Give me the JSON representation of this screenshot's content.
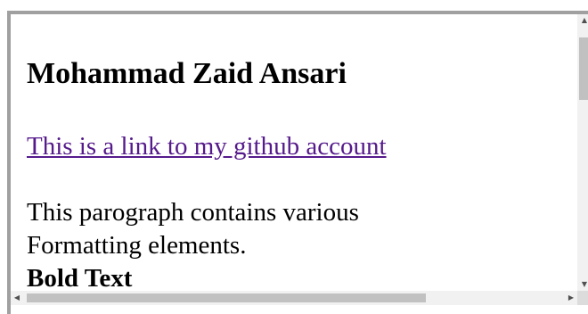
{
  "page": {
    "heading": "Mohammad Zaid Ansari",
    "link_text": "This is a link to my github account",
    "paragraph_line1": "This parograph contains various",
    "paragraph_line2": "Formatting elements.",
    "bold_text": "Bold Text"
  },
  "colors": {
    "link": "#551a8b",
    "frame_border": "#a0a0a0",
    "scrollbar_track": "#f1f1f1",
    "scrollbar_thumb": "#c1c1c1"
  },
  "icons": {
    "scroll_up": "▲",
    "scroll_down": "▼",
    "scroll_left": "◀",
    "scroll_right": "▶"
  }
}
